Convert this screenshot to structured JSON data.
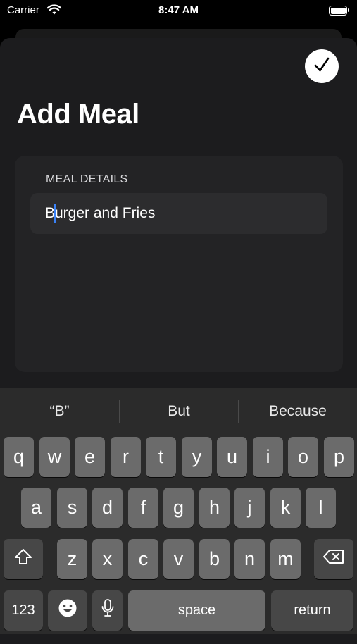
{
  "status_bar": {
    "carrier": "Carrier",
    "time": "8:47 AM",
    "battery_level": 1.0
  },
  "header": {
    "title": "Add Meal",
    "done_icon": "checkmark-icon"
  },
  "form": {
    "section_label": "MEAL DETAILS",
    "meal_field": {
      "value": "Burger and Fries"
    }
  },
  "keyboard": {
    "suggestions": [
      "“B”",
      "But",
      "Because"
    ],
    "row1": [
      "q",
      "w",
      "e",
      "r",
      "t",
      "y",
      "u",
      "i",
      "o",
      "p"
    ],
    "row2": [
      "a",
      "s",
      "d",
      "f",
      "g",
      "h",
      "j",
      "k",
      "l"
    ],
    "row3": [
      "z",
      "x",
      "c",
      "v",
      "b",
      "n",
      "m"
    ],
    "shift_icon": "shift-icon",
    "delete_icon": "delete-icon",
    "numbers_label": "123",
    "emoji_icon": "emoji-icon",
    "mic_icon": "microphone-icon",
    "space_label": "space",
    "return_label": "return"
  }
}
